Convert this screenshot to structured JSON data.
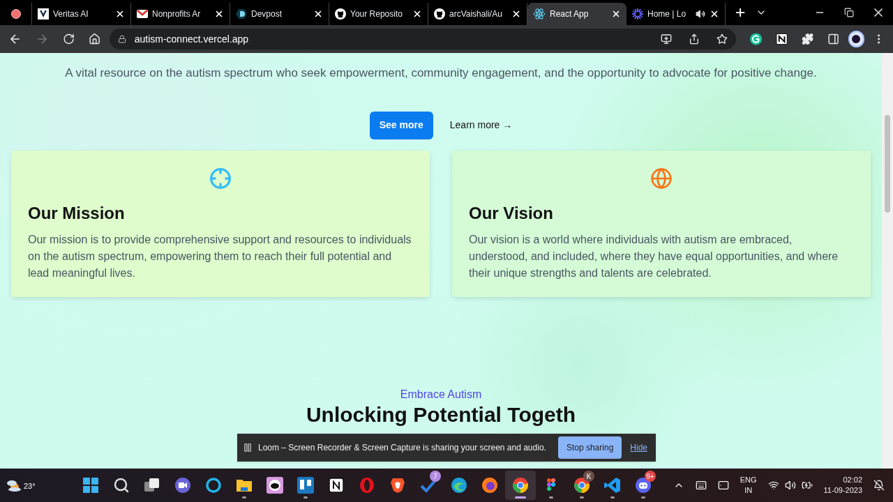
{
  "tabs": [
    {
      "kind": "recording",
      "selected": false
    },
    {
      "kind": "veritas",
      "title": "Veritas AI",
      "selected": false
    },
    {
      "kind": "mail",
      "title": "Nonprofits Ar",
      "selected": false
    },
    {
      "kind": "devpost",
      "title": "Devpost",
      "selected": false
    },
    {
      "kind": "github",
      "title": "Your Reposito",
      "selected": false
    },
    {
      "kind": "github",
      "title": "arcVaishali/Au",
      "selected": false
    },
    {
      "kind": "react",
      "title": "React App",
      "selected": true
    },
    {
      "kind": "loom",
      "title": "Home | Lo",
      "selected": false,
      "audio": true
    }
  ],
  "address": {
    "url": "autism-connect.vercel.app"
  },
  "page": {
    "tagline": "A vital resource on the autism spectrum who seek empowerment, community engagement, and the opportunity to advocate for positive change.",
    "primary_button": "See more",
    "secondary_link": "Learn more →",
    "cards": [
      {
        "kind": "target",
        "title": "Our Mission",
        "text": "Our mission is to provide comprehensive support and resources to individuals on the autism spectrum, empowering them to reach their full potential and lead meaningful lives."
      },
      {
        "kind": "globe",
        "title": "Our Vision",
        "text": "Our vision is a world where individuals with autism are embraced, understood, and included, where they have equal opportunities, and where their unique strengths and talents are celebrated."
      }
    ],
    "eyebrow": "Embrace Autism",
    "heading": "Unlocking Potential Togeth"
  },
  "share_bar": {
    "message": "Loom – Screen Recorder & Screen Capture is sharing your screen and audio.",
    "stop_button": "Stop sharing",
    "hide_link": "Hide"
  },
  "taskbar": {
    "weather": "23°",
    "apps": [
      {
        "kind": "start",
        "running": false,
        "selected": false
      },
      {
        "kind": "search",
        "running": false,
        "selected": false
      },
      {
        "kind": "taskview",
        "running": false,
        "selected": false
      },
      {
        "kind": "meet",
        "running": false,
        "selected": false
      },
      {
        "kind": "ring",
        "running": false,
        "selected": false
      },
      {
        "kind": "folder",
        "running": true,
        "selected": false
      },
      {
        "kind": "cat",
        "running": false,
        "selected": false
      },
      {
        "kind": "board",
        "running": true,
        "selected": false
      },
      {
        "kind": "notion",
        "running": false,
        "selected": false
      },
      {
        "kind": "opera",
        "running": false,
        "selected": false
      },
      {
        "kind": "shield",
        "running": false,
        "selected": false
      },
      {
        "kind": "todo",
        "running": false,
        "selected": false,
        "badge": "7"
      },
      {
        "kind": "edge",
        "running": false,
        "selected": false
      },
      {
        "kind": "fox",
        "running": false,
        "selected": false
      },
      {
        "kind": "chrome",
        "running": true,
        "selected": true
      },
      {
        "kind": "figma",
        "running": true,
        "selected": false
      },
      {
        "kind": "chrome",
        "running": true,
        "selected": false,
        "badge": "K"
      },
      {
        "kind": "code",
        "running": true,
        "selected": false
      },
      {
        "kind": "discord",
        "running": true,
        "selected": false,
        "badge": "9+"
      }
    ],
    "language": "ENG",
    "region": "IN",
    "time": "02:02",
    "date": "11-09-2023"
  }
}
